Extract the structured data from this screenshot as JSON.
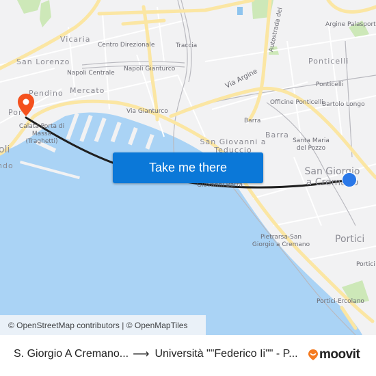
{
  "map": {
    "attribution": "© OpenStreetMap contributors | © OpenMapTiles",
    "labels": {
      "vicaria": "Vicaria",
      "centro_direzionale": "Centro Direzionale",
      "traccia": "Traccia",
      "argine_palasport": "Argine Palasport",
      "autostrada": "Autostrada del",
      "san_lorenzo": "San Lorenzo",
      "napoli_centrale": "Napoli Centrale",
      "napoli_gianturco": "Napoli Gianturco",
      "ponticelli_district": "Ponticelli",
      "ponticelli_station": "Ponticelli",
      "via_argine": "Via Argine",
      "pendino": "Pendino",
      "mercato": "Mercato",
      "porto": "Por",
      "via_gianturco": "Via Gianturco",
      "officine_ponticelli": "Officine Ponticelli",
      "bartolo_longo": "Bartolo Longo",
      "calata_porta_di_massa": "Calata Porta di Massa (Traghetti)",
      "barra_station": "Barra",
      "barra_district": "Barra",
      "napoli": "oli",
      "san_giovanni": "San Giovanni a Teduccio",
      "santa_maria_del_pozzo": "Santa Maria del Pozzo",
      "chiaia_fragment": "ndo",
      "san_giorgio": "San Giorgio a Cremano",
      "giovanni_barra": "Giovanni Barra",
      "pietrarsa": "Pietrarsa-San Giorgio a Cremano",
      "portici": "Portici",
      "portici_station": "Portici V",
      "portici_ercolano": "Portici-Ercolano"
    },
    "origin_marker": "origin-dot",
    "destination_marker": "destination-pin",
    "colors": {
      "sea": "#aad3f5",
      "land": "#f2f2f3",
      "road_major": "#fbe6a3",
      "route": "#1f1f1f",
      "origin": "#2a78e8",
      "destination": "#f4511e",
      "button": "#0b78d8",
      "park": "#cde8b8"
    }
  },
  "cta": {
    "label": "Take me there"
  },
  "footer": {
    "origin": "S. Giorgio A Cremano...",
    "arrow": "⟶",
    "destination": "Università \"\"Federico Ii\"\" - P...",
    "brand": "moovit"
  }
}
